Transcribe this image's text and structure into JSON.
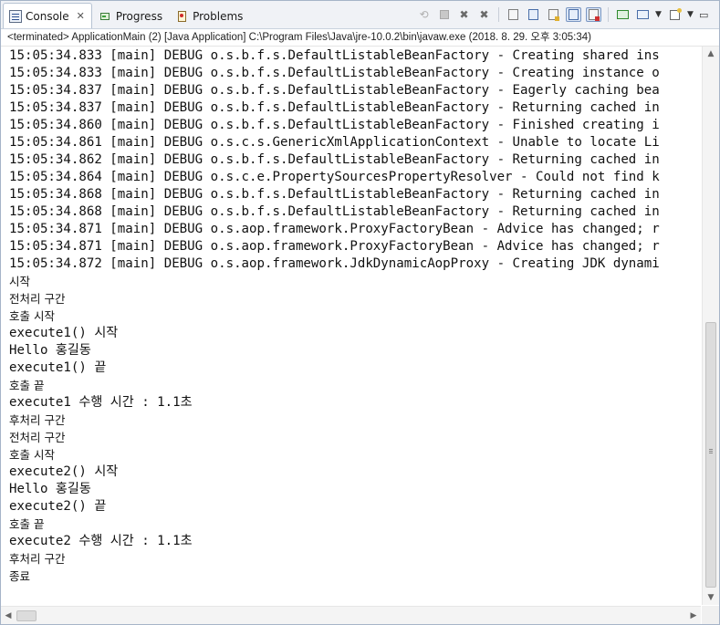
{
  "tabs": [
    {
      "label": "Console",
      "active": true,
      "icon": "console-icon",
      "closable": true
    },
    {
      "label": "Progress",
      "active": false,
      "icon": "progress-icon"
    },
    {
      "label": "Problems",
      "active": false,
      "icon": "problems-icon"
    }
  ],
  "toolbar": {
    "icons": [
      "remove-launch-icon",
      "terminate-icon",
      "remove-terminated-icon",
      "remove-all-terminated-icon",
      "clear-console-icon",
      "scroll-lock-icon",
      "word-wrap-icon",
      "show-on-stdout-icon",
      "show-on-stderr-icon",
      "pin-console-icon",
      "display-selected-console-icon",
      "open-console-icon",
      "minimize-icon"
    ]
  },
  "status_line": "<terminated> ApplicationMain (2) [Java Application] C:\\Program Files\\Java\\jre-10.0.2\\bin\\javaw.exe (2018. 8. 29. 오후 3:05:34)",
  "console_lines": [
    "15:05:34.833 [main] DEBUG o.s.b.f.s.DefaultListableBeanFactory - Creating shared ins",
    "15:05:34.833 [main] DEBUG o.s.b.f.s.DefaultListableBeanFactory - Creating instance o",
    "15:05:34.837 [main] DEBUG o.s.b.f.s.DefaultListableBeanFactory - Eagerly caching bea",
    "15:05:34.837 [main] DEBUG o.s.b.f.s.DefaultListableBeanFactory - Returning cached in",
    "15:05:34.860 [main] DEBUG o.s.b.f.s.DefaultListableBeanFactory - Finished creating i",
    "15:05:34.861 [main] DEBUG o.s.c.s.GenericXmlApplicationContext - Unable to locate Li",
    "15:05:34.862 [main] DEBUG o.s.b.f.s.DefaultListableBeanFactory - Returning cached in",
    "15:05:34.864 [main] DEBUG o.s.c.e.PropertySourcesPropertyResolver - Could not find k",
    "15:05:34.868 [main] DEBUG o.s.b.f.s.DefaultListableBeanFactory - Returning cached in",
    "15:05:34.868 [main] DEBUG o.s.b.f.s.DefaultListableBeanFactory - Returning cached in",
    "15:05:34.871 [main] DEBUG o.s.aop.framework.ProxyFactoryBean - Advice has changed; r",
    "15:05:34.871 [main] DEBUG o.s.aop.framework.ProxyFactoryBean - Advice has changed; r",
    "15:05:34.872 [main] DEBUG o.s.aop.framework.JdkDynamicAopProxy - Creating JDK dynami",
    "시작",
    "전처리 구간",
    "호출 시작",
    "execute1() 시작",
    "Hello 홍길동",
    "execute1() 끝",
    "호출 끝",
    "execute1 수행 시간 : 1.1초",
    "후처리 구간",
    "전처리 구간",
    "호출 시작",
    "execute2() 시작",
    "Hello 홍길동",
    "execute2() 끝",
    "호출 끝",
    "execute2 수행 시간 : 1.1초",
    "후처리 구간",
    "종료"
  ],
  "scrollbars": {
    "vertical_position": 0.49,
    "vertical_visible_fraction": 0.48,
    "horizontal_position": 0.0
  },
  "colors": {
    "tabbar_bg": "#f0f2f6",
    "text": "#111111",
    "border": "#a6b4c8"
  }
}
